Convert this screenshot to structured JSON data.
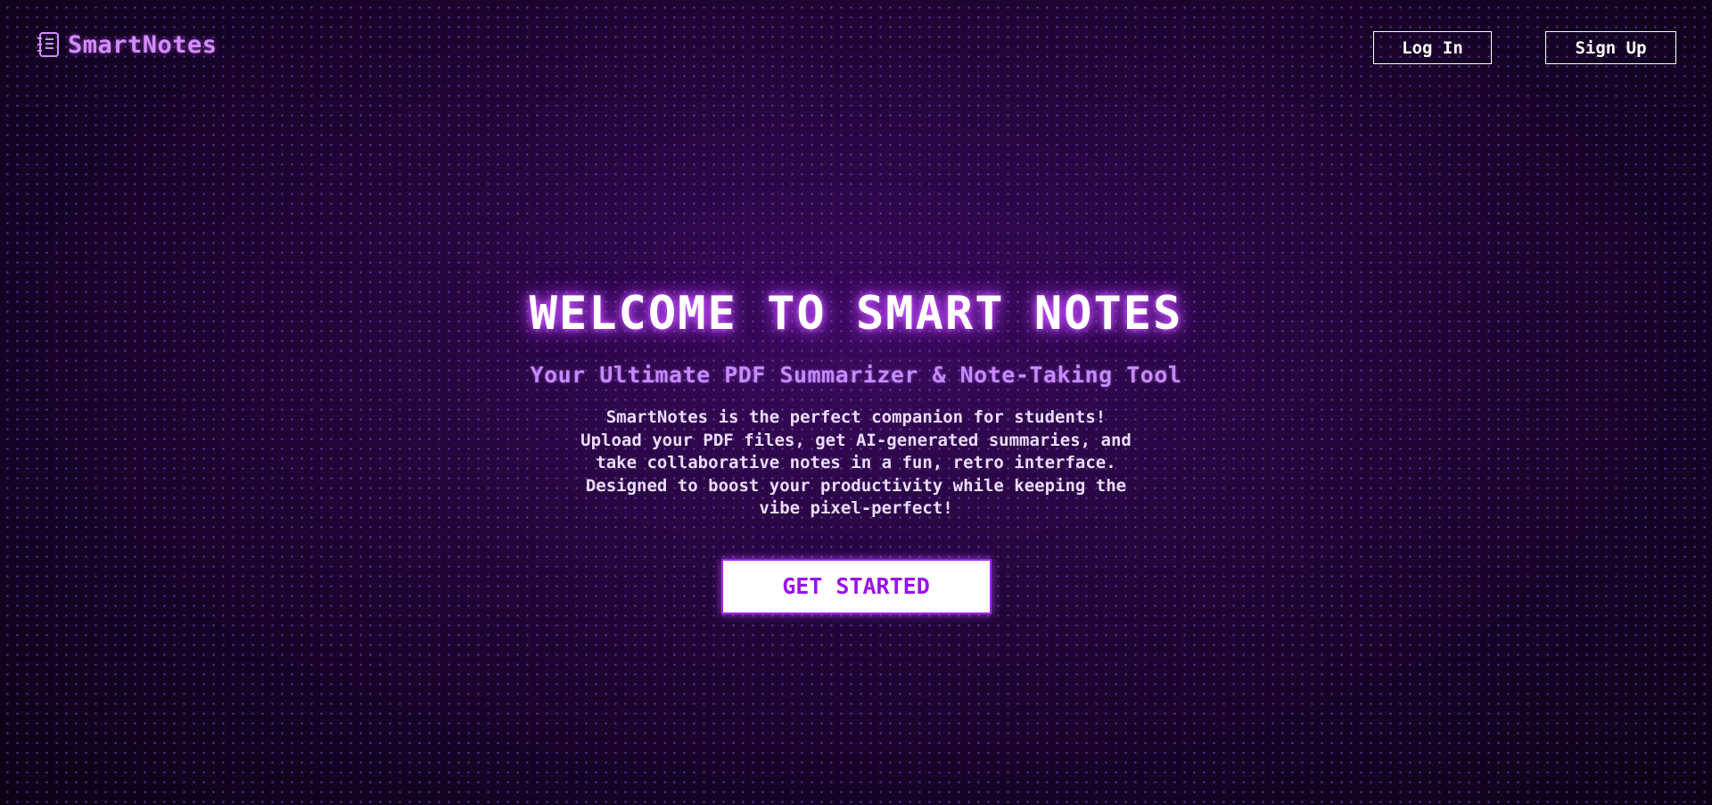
{
  "header": {
    "brand_name": "SmartNotes",
    "brand_icon": "notebook-icon",
    "login_label": "Log In",
    "signup_label": "Sign Up"
  },
  "hero": {
    "title": "WELCOME TO SMART NOTES",
    "subtitle": "Your Ultimate PDF Summarizer & Note-Taking Tool",
    "description_lines": [
      "SmartNotes is the perfect companion for students!",
      "Upload your PDF files, get AI-generated summaries, and",
      "take collaborative notes in a fun, retro interface.",
      "Designed to boost your productivity while keeping the",
      "vibe pixel-perfect!"
    ],
    "cta_label": "GET STARTED"
  },
  "colors": {
    "background": "#1a0228",
    "accent": "#b43cff",
    "brand": "#d38cff",
    "subtitle": "#c58aff",
    "cta_text": "#9a10ee"
  }
}
